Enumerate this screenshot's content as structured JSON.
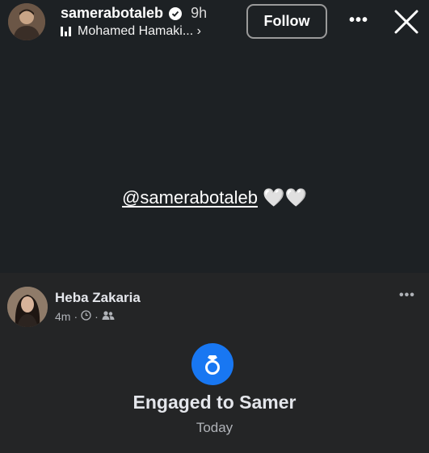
{
  "story": {
    "username": "samerabotaleb",
    "time_ago": "9h",
    "music_label": "Mohamed Hamaki... ›",
    "follow_label": "Follow",
    "more_label": "•••",
    "mention_handle": "@samerabotaleb",
    "mention_emoji": "🤍🤍"
  },
  "post": {
    "author": "Heba Zakaria",
    "time_ago": "4m",
    "meta_sep": "·",
    "more_label": "•••",
    "event_title": "Engaged to Samer",
    "event_date": "Today"
  },
  "colors": {
    "accent": "#1877f2",
    "story_bg": "#1d2124",
    "post_bg": "#242526"
  }
}
